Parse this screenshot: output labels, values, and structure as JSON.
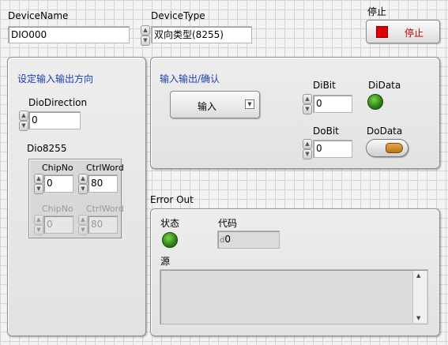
{
  "device_name": {
    "label": "DeviceName",
    "value": "DIO000"
  },
  "device_type": {
    "label": "DeviceType",
    "value": "双向类型(8255)"
  },
  "stop": {
    "label": "停止",
    "button_label": "停止",
    "indicator_color": "#e00000"
  },
  "direction_panel": {
    "title": "设定输入输出方向",
    "dio_direction": {
      "label": "DioDirection",
      "value": "0"
    },
    "dio8255": {
      "label": "Dio8255",
      "rows": [
        {
          "chip_label": "ChipNo",
          "chip_value": "0",
          "ctrl_label": "CtrlWord",
          "ctrl_value": "80",
          "enabled": true
        },
        {
          "chip_label": "ChipNo",
          "chip_value": "0",
          "ctrl_label": "CtrlWord",
          "ctrl_value": "80",
          "enabled": false
        }
      ]
    }
  },
  "io_panel": {
    "title": "输入输出/确认",
    "mode_select": {
      "value": "输入"
    },
    "dibit": {
      "label": "DiBit",
      "value": "0"
    },
    "didata": {
      "label": "DiData",
      "state": "on",
      "color": "#2e7d17"
    },
    "dobit": {
      "label": "DoBit",
      "value": "0"
    },
    "dodata": {
      "label": "DoData",
      "state": "off",
      "color": "#c98a2a"
    }
  },
  "error_out": {
    "label": "Error Out",
    "status_label": "状态",
    "code_label": "代码",
    "code_value": "0",
    "code_prefix": "d",
    "source_label": "源",
    "source_value": "",
    "status_color": "#2e7d17"
  }
}
